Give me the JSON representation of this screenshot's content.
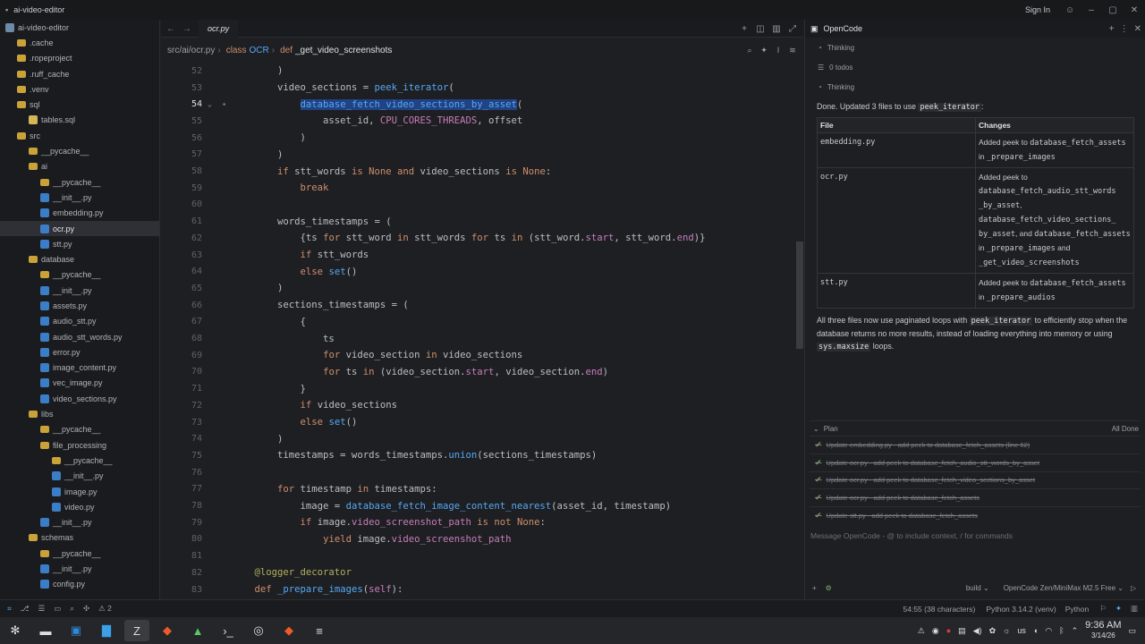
{
  "window": {
    "title": "ai-video-editor",
    "sign_in": "Sign In"
  },
  "sidebar": {
    "root": "ai-video-editor",
    "items": [
      {
        "label": ".cache",
        "icon": "folder-icon",
        "indent": 1
      },
      {
        "label": ".ropeproject",
        "icon": "folder-icon",
        "indent": 1
      },
      {
        "label": ".ruff_cache",
        "icon": "folder-icon",
        "indent": 1
      },
      {
        "label": ".venv",
        "icon": "folder-icon",
        "indent": 1
      },
      {
        "label": "sql",
        "icon": "folder-icon",
        "indent": 1
      },
      {
        "label": "tables.sql",
        "icon": "sql-file-icon",
        "indent": 2
      },
      {
        "label": "src",
        "icon": "folder-icon",
        "indent": 1
      },
      {
        "label": "__pycache__",
        "icon": "folder-icon",
        "indent": 2
      },
      {
        "label": "ai",
        "icon": "folder-icon",
        "indent": 2
      },
      {
        "label": "__pycache__",
        "icon": "folder-icon",
        "indent": 3
      },
      {
        "label": "__init__.py",
        "icon": "python-file-icon",
        "indent": 3
      },
      {
        "label": "embedding.py",
        "icon": "python-file-icon",
        "indent": 3
      },
      {
        "label": "ocr.py",
        "icon": "python-file-icon",
        "indent": 3
      },
      {
        "label": "stt.py",
        "icon": "python-file-icon",
        "indent": 3
      },
      {
        "label": "database",
        "icon": "folder-icon",
        "indent": 2
      },
      {
        "label": "__pycache__",
        "icon": "folder-icon",
        "indent": 3
      },
      {
        "label": "__init__.py",
        "icon": "python-file-icon",
        "indent": 3
      },
      {
        "label": "assets.py",
        "icon": "python-file-icon",
        "indent": 3
      },
      {
        "label": "audio_stt.py",
        "icon": "python-file-icon",
        "indent": 3
      },
      {
        "label": "audio_stt_words.py",
        "icon": "python-file-icon",
        "indent": 3
      },
      {
        "label": "error.py",
        "icon": "python-file-icon",
        "indent": 3
      },
      {
        "label": "image_content.py",
        "icon": "python-file-icon",
        "indent": 3
      },
      {
        "label": "vec_image.py",
        "icon": "python-file-icon",
        "indent": 3
      },
      {
        "label": "video_sections.py",
        "icon": "python-file-icon",
        "indent": 3
      },
      {
        "label": "libs",
        "icon": "folder-icon",
        "indent": 2
      },
      {
        "label": "__pycache__",
        "icon": "folder-icon",
        "indent": 3
      },
      {
        "label": "file_processing",
        "icon": "folder-icon",
        "indent": 3
      },
      {
        "label": "__pycache__",
        "icon": "folder-icon",
        "indent": 4
      },
      {
        "label": "__init__.py",
        "icon": "python-file-icon",
        "indent": 4
      },
      {
        "label": "image.py",
        "icon": "python-file-icon",
        "indent": 4
      },
      {
        "label": "video.py",
        "icon": "python-file-icon",
        "indent": 4
      },
      {
        "label": "__init__.py",
        "icon": "python-file-icon",
        "indent": 3
      },
      {
        "label": "schemas",
        "icon": "folder-icon",
        "indent": 2
      },
      {
        "label": "__pycache__",
        "icon": "folder-icon",
        "indent": 3
      },
      {
        "label": "__init__.py",
        "icon": "python-file-icon",
        "indent": 3
      },
      {
        "label": "config.py",
        "icon": "python-file-icon",
        "indent": 3
      }
    ],
    "selected": "ocr.py"
  },
  "editor": {
    "tab": "ocr.py",
    "breadcrumb": {
      "path": "src/ai/ocr.py",
      "kw_class": "class",
      "class_name": "OCR",
      "kw_def": "def",
      "func_name": "_get_video_screenshots"
    },
    "current_line": "54"
  },
  "panel": {
    "title": "OpenCode",
    "status": [
      "Thinking",
      "0 todos",
      "Thinking"
    ],
    "message_pre": "Done. Updated 3 files to use ",
    "message_code": "peek_iterator",
    "message_post": ":",
    "table_headers": [
      "File",
      "Changes"
    ],
    "rows": [
      {
        "file": "embedding.py"
      },
      {
        "file": "ocr.py"
      },
      {
        "file": "stt.py"
      }
    ],
    "summary_a": "All three files now use paginated loops with ",
    "summary_code1": "peek_iterator",
    "summary_b": " to efficiently stop when the database returns no more results, instead of loading everything into memory or using ",
    "summary_code2": "sys.maxsize",
    "summary_c": " loops.",
    "plan_title": "Plan",
    "plan_done": "All Done",
    "plan_items": [
      "Update embedding.py - add peek to database_fetch_assets (line 62)",
      "Update ocr.py - add peek to database_fetch_audio_stt_words_by_asset",
      "Update ocr.py - add peek to database_fetch_video_sections_by_asset",
      "Update ocr.py - add peek to database_fetch_assets",
      "Update stt.py - add peek to database_fetch_assets"
    ],
    "input_placeholder": "Message OpenCode - @ to include context, / for commands",
    "mode": "build",
    "model": "OpenCode Zen/MiniMax M2.5 Free"
  },
  "statusbar": {
    "warnings": "2",
    "position": "54:55 (38 characters)",
    "interpreter": "Python 3.14.2 (venv)",
    "language": "Python"
  },
  "taskbar": {
    "time": "9:36 AM",
    "date": "3/14/26",
    "keyboard": "us"
  }
}
